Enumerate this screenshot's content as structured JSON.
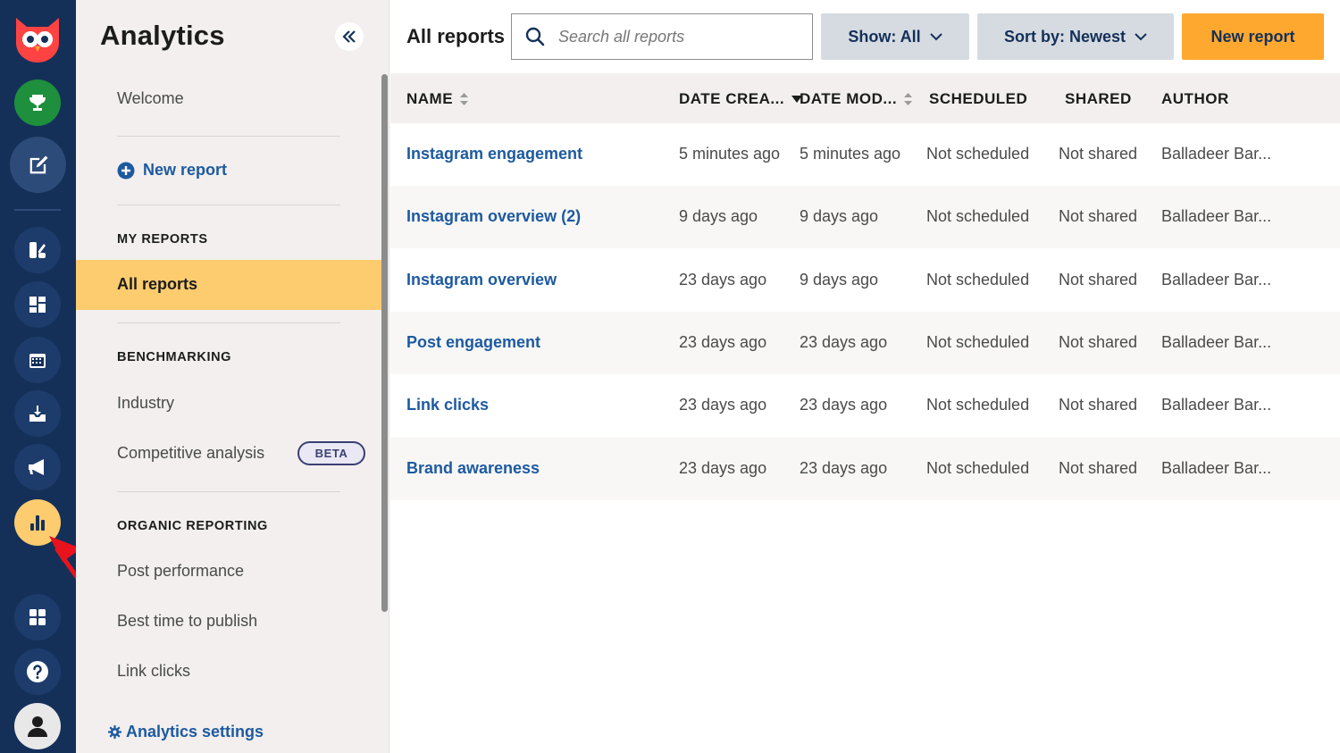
{
  "colors": {
    "rail_bg": "#143059",
    "nav_bg": "#f2efee",
    "active_item": "#fdcc6f",
    "link": "#1d5aa0",
    "primary_button": "#fea82f",
    "dropdown_bg": "#d6dbe1",
    "annotation_arrow": "#e8131d"
  },
  "rail": {
    "items": [
      {
        "name": "owl-logo",
        "icon": "owl-icon",
        "active": false
      },
      {
        "name": "goals",
        "icon": "trophy-icon",
        "active": false
      },
      {
        "name": "compose",
        "icon": "compose-icon",
        "active": false
      },
      {
        "name": "streams",
        "icon": "streams-icon",
        "active": false
      },
      {
        "name": "dashboard",
        "icon": "dashboard-icon",
        "active": false
      },
      {
        "name": "planner",
        "icon": "calendar-icon",
        "active": false
      },
      {
        "name": "inbox",
        "icon": "inbox-icon",
        "active": false
      },
      {
        "name": "advertise",
        "icon": "megaphone-icon",
        "active": false
      },
      {
        "name": "analytics",
        "icon": "bar-chart-icon",
        "active": true
      },
      {
        "name": "apps",
        "icon": "apps-icon",
        "active": false
      },
      {
        "name": "help",
        "icon": "help-icon",
        "active": false
      },
      {
        "name": "profile",
        "icon": "user-icon",
        "active": false
      }
    ]
  },
  "nav": {
    "title": "Analytics",
    "welcome": "Welcome",
    "new_report": "New report",
    "my_reports_heading": "MY REPORTS",
    "all_reports": "All reports",
    "benchmarking_heading": "BENCHMARKING",
    "industry": "Industry",
    "competitive_analysis": "Competitive analysis",
    "beta_badge": "BETA",
    "organic_heading": "ORGANIC REPORTING",
    "post_performance": "Post performance",
    "best_time": "Best time to publish",
    "link_clicks": "Link clicks",
    "settings": "Analytics settings"
  },
  "toolbar": {
    "page_title": "All reports",
    "search_placeholder": "Search all reports",
    "show_label": "Show: All",
    "sort_label": "Sort by: Newest",
    "new_report_label": "New report"
  },
  "table": {
    "columns": [
      "NAME",
      "DATE CREA...",
      "DATE MOD...",
      "SCHEDULED",
      "SHARED",
      "AUTHOR"
    ],
    "rows": [
      {
        "name": "Instagram engagement",
        "created": "5 minutes ago",
        "modified": "5 minutes ago",
        "scheduled": "Not scheduled",
        "shared": "Not shared",
        "author": "Balladeer Bar..."
      },
      {
        "name": "Instagram overview (2)",
        "created": "9 days ago",
        "modified": "9 days ago",
        "scheduled": "Not scheduled",
        "shared": "Not shared",
        "author": "Balladeer Bar..."
      },
      {
        "name": "Instagram overview",
        "created": "23 days ago",
        "modified": "9 days ago",
        "scheduled": "Not scheduled",
        "shared": "Not shared",
        "author": "Balladeer Bar..."
      },
      {
        "name": "Post engagement",
        "created": "23 days ago",
        "modified": "23 days ago",
        "scheduled": "Not scheduled",
        "shared": "Not shared",
        "author": "Balladeer Bar..."
      },
      {
        "name": "Link clicks",
        "created": "23 days ago",
        "modified": "23 days ago",
        "scheduled": "Not scheduled",
        "shared": "Not shared",
        "author": "Balladeer Bar..."
      },
      {
        "name": "Brand awareness",
        "created": "23 days ago",
        "modified": "23 days ago",
        "scheduled": "Not scheduled",
        "shared": "Not shared",
        "author": "Balladeer Bar..."
      }
    ]
  }
}
